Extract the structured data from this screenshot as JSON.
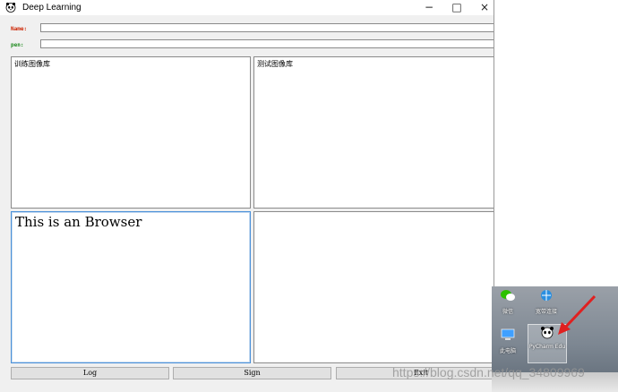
{
  "window": {
    "title": "Deep Learning",
    "min_glyph": "−",
    "max_glyph": "□",
    "close_glyph": "×"
  },
  "form": {
    "name_label": "Name:",
    "name_value": "",
    "pen_label": "pen:",
    "pen_value": ""
  },
  "panels": {
    "train_title": "训练图像库",
    "test_title": "测试图像库",
    "browser_text": "This is an Browser",
    "output_text": ""
  },
  "buttons": {
    "log": "Log",
    "sign": "Sign",
    "exit": "Exit"
  },
  "desktop": {
    "items": [
      {
        "label": "微信",
        "icon": "wechat-icon"
      },
      {
        "label": "宽带连接",
        "icon": "network-icon"
      },
      {
        "label": "此电脑",
        "icon": "pc-icon"
      },
      {
        "label": "PyCharm Edu",
        "icon": "pycharm-icon"
      }
    ]
  },
  "watermark": "https://blog.csdn.net/qq_34809969",
  "colors": {
    "name_label": "#cc2200",
    "pen_label": "#1e8a1e",
    "browser_border": "#4a90d9",
    "arrow": "#e02020"
  }
}
